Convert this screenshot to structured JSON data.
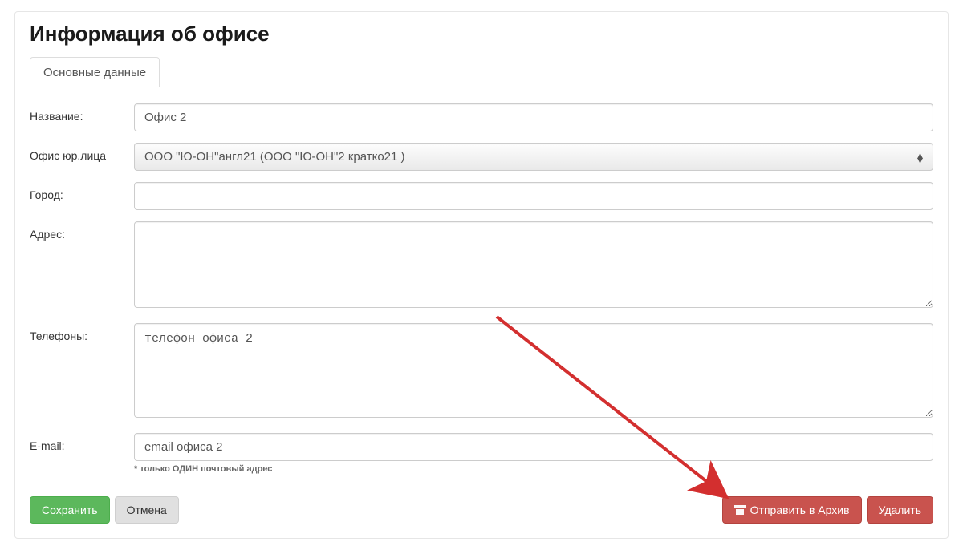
{
  "header": {
    "title": "Информация об офисе"
  },
  "tabs": [
    {
      "label": "Основные данные"
    }
  ],
  "form": {
    "name": {
      "label": "Название:",
      "value": "Офис 2"
    },
    "legal": {
      "label": "Офис юр.лица",
      "selected": "ООО \"Ю-ОН\"англ21 (ООО \"Ю-ОН\"2 кратко21 )"
    },
    "city": {
      "label": "Город:",
      "value": ""
    },
    "address": {
      "label": "Адрес:",
      "value": ""
    },
    "phones": {
      "label": "Телефоны:",
      "value": "телефон офиса 2"
    },
    "email": {
      "label": "E-mail:",
      "value": "email офиса 2",
      "helper": "* только ОДИН почтовый адрес"
    }
  },
  "actions": {
    "save": "Сохранить",
    "cancel": "Отмена",
    "archive": "Отправить в Архив",
    "delete": "Удалить"
  },
  "colors": {
    "arrow": "#d32f2f"
  }
}
